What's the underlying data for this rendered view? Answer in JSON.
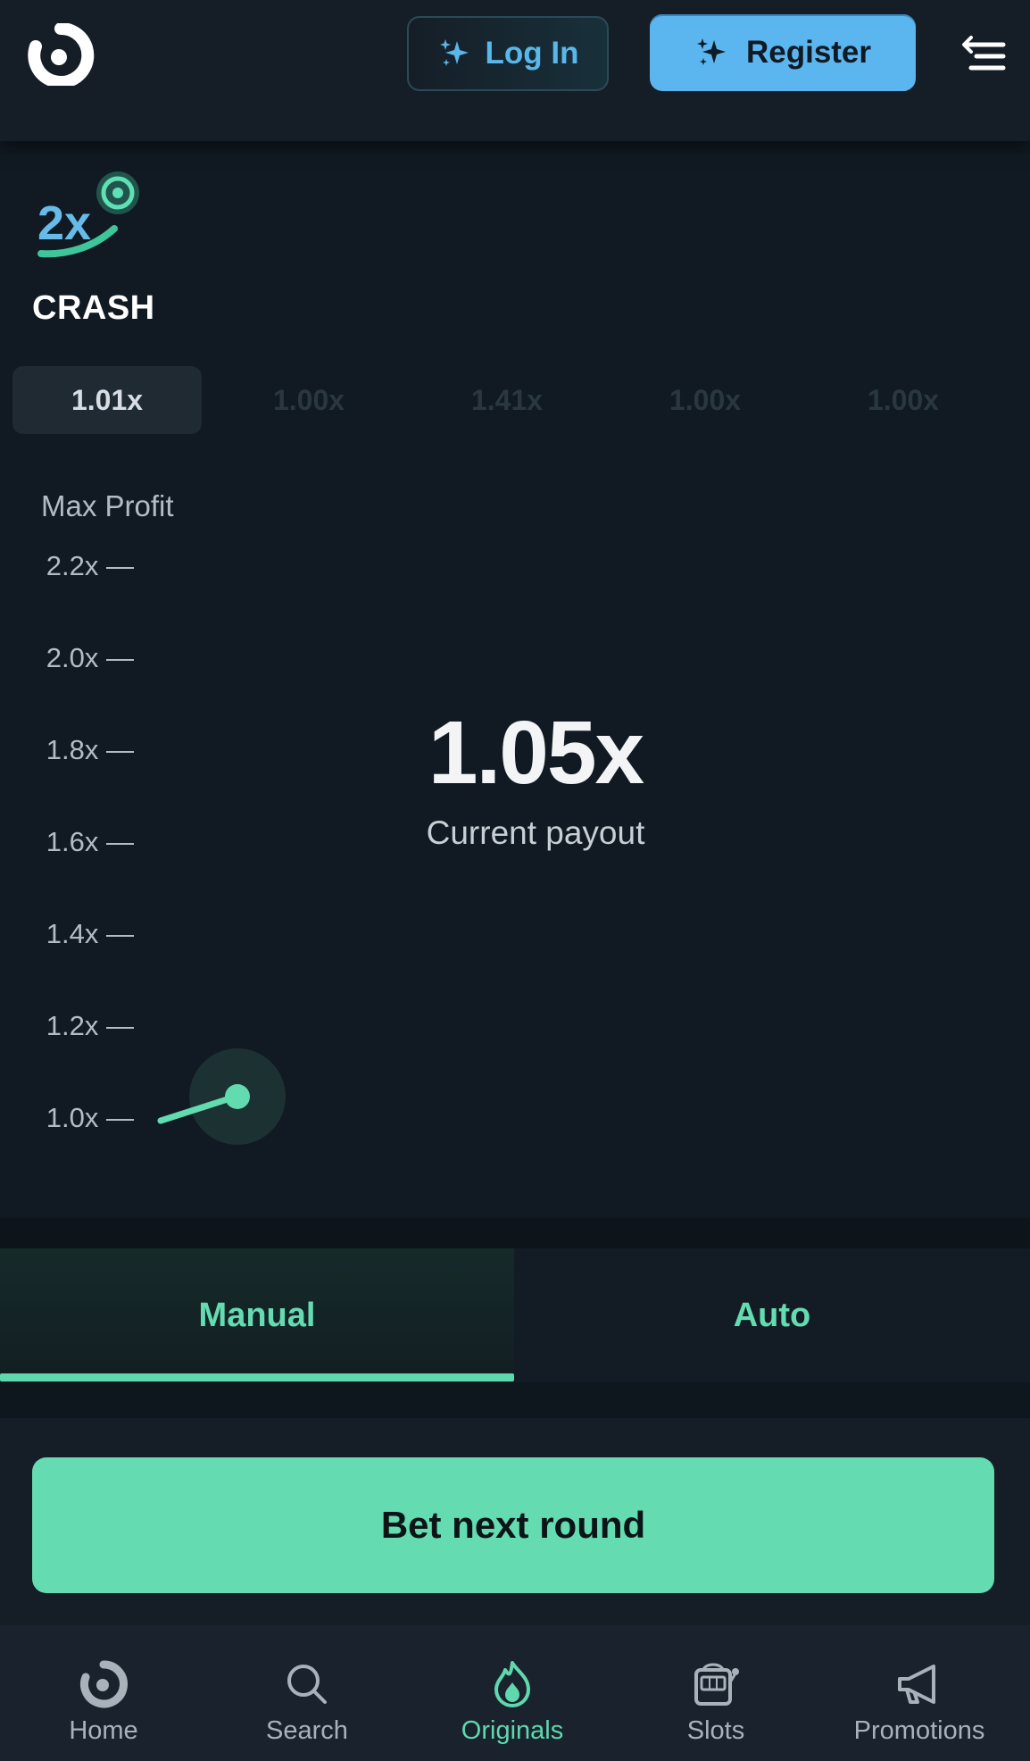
{
  "header": {
    "login_label": "Log In",
    "register_label": "Register"
  },
  "game": {
    "title": "CRASH",
    "icon_text": "2x"
  },
  "history": [
    "1.01x",
    "1.00x",
    "1.41x",
    "1.00x",
    "1.00x"
  ],
  "chart": {
    "axis_label": "Max Profit",
    "ticks": [
      "2.2x —",
      "2.0x —",
      "1.8x —",
      "1.6x —",
      "1.4x —",
      "1.2x —",
      "1.0x —"
    ]
  },
  "payout": {
    "value": "1.05x",
    "label": "Current payout"
  },
  "tabs": {
    "manual": "Manual",
    "auto": "Auto",
    "active": "manual"
  },
  "bet": {
    "label": "Bet next round"
  },
  "nav": {
    "home": "Home",
    "search": "Search",
    "originals": "Originals",
    "slots": "Slots",
    "promotions": "Promotions",
    "active": "originals"
  },
  "colors": {
    "accent_green": "#64dbb1",
    "accent_blue": "#5bb5ee",
    "background": "#111a22"
  }
}
